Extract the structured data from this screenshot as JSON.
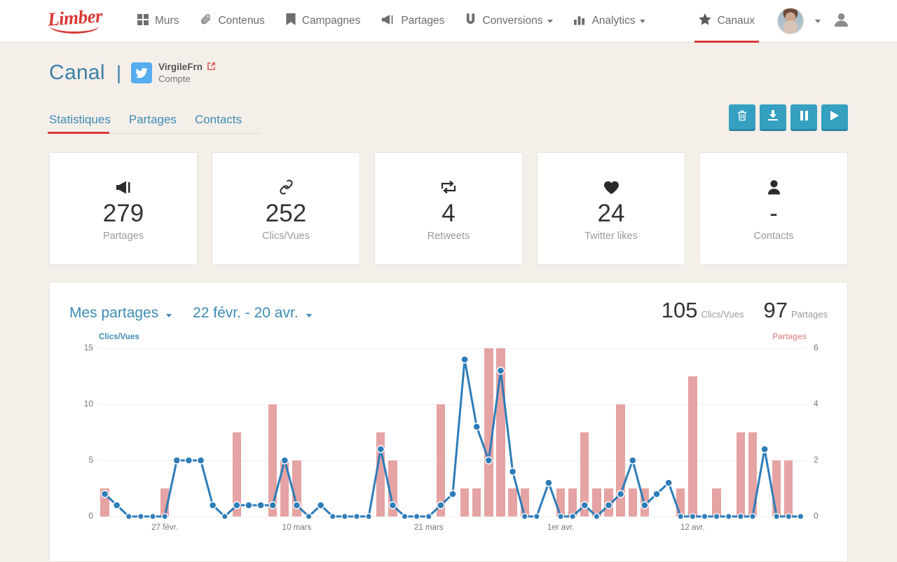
{
  "brand": {
    "name": "Limber"
  },
  "nav": {
    "items": [
      {
        "label": "Murs",
        "icon": "grid-icon",
        "caret": false
      },
      {
        "label": "Contenus",
        "icon": "paperclip-icon",
        "caret": false
      },
      {
        "label": "Campagnes",
        "icon": "bookmark-icon",
        "caret": false
      },
      {
        "label": "Partages",
        "icon": "megaphone-icon",
        "caret": false
      },
      {
        "label": "Conversions",
        "icon": "magnet-icon",
        "caret": true
      },
      {
        "label": "Analytics",
        "icon": "bar-chart-icon",
        "caret": true
      }
    ],
    "right": {
      "label": "Canaux",
      "icon": "star-icon"
    }
  },
  "header": {
    "title": "Canal",
    "separator": "|",
    "account_name": "VirgileFrn",
    "account_sub": "Compte",
    "network_icon": "twitter-icon",
    "external_link_icon": "external-link-icon"
  },
  "tabs": [
    {
      "label": "Statistiques",
      "active": true
    },
    {
      "label": "Partages",
      "active": false
    },
    {
      "label": "Contacts",
      "active": false
    }
  ],
  "actions": [
    {
      "name": "delete-button",
      "icon": "trash-icon",
      "glyph": "Ὕ1"
    },
    {
      "name": "download-button",
      "icon": "download-icon",
      "glyph": "↓"
    },
    {
      "name": "pause-button",
      "icon": "pause-icon",
      "glyph": "❙❙"
    },
    {
      "name": "play-button",
      "icon": "play-icon",
      "glyph": "▶"
    }
  ],
  "stats": [
    {
      "icon": "megaphone-icon",
      "value": "279",
      "label": "Partages"
    },
    {
      "icon": "link-icon",
      "value": "252",
      "label": "Clics/Vues"
    },
    {
      "icon": "retweet-icon",
      "value": "4",
      "label": "Retweets"
    },
    {
      "icon": "heart-icon",
      "value": "24",
      "label": "Twitter likes"
    },
    {
      "icon": "person-icon",
      "value": "-",
      "label": "Contacts"
    }
  ],
  "chart_panel": {
    "source_filter": "Mes partages",
    "date_range": "22 févr. - 20 avr.",
    "total_clicks": "105",
    "total_clicks_label": "Clics/Vues",
    "total_shares": "97",
    "total_shares_label": "Partages"
  },
  "colors": {
    "brand_red": "#d83a36",
    "link_blue": "#3d8bb5",
    "line_blue": "#2e7cb8",
    "bar_pink": "#e5a3a3",
    "action_teal": "#35a0c0",
    "page_bg": "#f4efe9"
  },
  "chart_data": {
    "type": "bar",
    "title": "",
    "xlabel": "",
    "ylabel": "Clics/Vues",
    "y2label": "Partages",
    "ylim": [
      0,
      15
    ],
    "y2lim": [
      0,
      6
    ],
    "yticks": [
      0,
      5,
      10,
      15
    ],
    "y2ticks": [
      0,
      2,
      4,
      6
    ],
    "grid": true,
    "legend": "axis-labels",
    "xtick_labels": [
      "27 févr.",
      "10 mars",
      "21 mars",
      "1er avr.",
      "12 avr."
    ],
    "xtick_index": [
      5,
      16,
      27,
      38,
      49
    ],
    "x": [
      "22 févr.",
      "23 févr.",
      "24 févr.",
      "25 févr.",
      "26 févr.",
      "27 févr.",
      "28 févr.",
      "29 févr.",
      "1 mars",
      "2 mars",
      "3 mars",
      "4 mars",
      "5 mars",
      "6 mars",
      "7 mars",
      "8 mars",
      "9 mars",
      "10 mars",
      "11 mars",
      "12 mars",
      "13 mars",
      "14 mars",
      "15 mars",
      "16 mars",
      "17 mars",
      "18 mars",
      "19 mars",
      "20 mars",
      "21 mars",
      "22 mars",
      "23 mars",
      "24 mars",
      "25 mars",
      "26 mars",
      "27 mars",
      "28 mars",
      "29 mars",
      "30 mars",
      "31 mars",
      "1er avr.",
      "2 avr.",
      "3 avr.",
      "4 avr.",
      "5 avr.",
      "6 avr.",
      "7 avr.",
      "8 avr.",
      "9 avr.",
      "10 avr.",
      "11 avr.",
      "12 avr.",
      "13 avr.",
      "14 avr.",
      "15 avr.",
      "16 avr.",
      "17 avr.",
      "18 avr.",
      "19 avr.",
      "20 avr."
    ],
    "series": [
      {
        "name": "Partages",
        "type": "bar",
        "axis": "right",
        "color": "#e5a3a3",
        "values": [
          1,
          0,
          0,
          0,
          0,
          1,
          0,
          0,
          0,
          0,
          0,
          3,
          0,
          0,
          4,
          2,
          2,
          0,
          0,
          0,
          0,
          0,
          0,
          3,
          2,
          0,
          0,
          0,
          4,
          0,
          1,
          1,
          6,
          6,
          1,
          1,
          0,
          0,
          1,
          1,
          3,
          1,
          1,
          4,
          1,
          1,
          0,
          0,
          1,
          5,
          0,
          1,
          0,
          3,
          3,
          0,
          2,
          2,
          0
        ]
      },
      {
        "name": "Clics/Vues",
        "type": "line",
        "axis": "left",
        "color": "#2e7cb8",
        "values": [
          2,
          1,
          0,
          0,
          0,
          0,
          5,
          5,
          5,
          1,
          0,
          1,
          1,
          1,
          1,
          5,
          1,
          0,
          1,
          0,
          0,
          0,
          0,
          6,
          1,
          0,
          0,
          0,
          1,
          2,
          14,
          8,
          5,
          13,
          4,
          0,
          0,
          3,
          0,
          0,
          1,
          0,
          1,
          2,
          5,
          1,
          2,
          3,
          0,
          0,
          0,
          0,
          0,
          0,
          0,
          6,
          0,
          0,
          0
        ]
      }
    ]
  }
}
